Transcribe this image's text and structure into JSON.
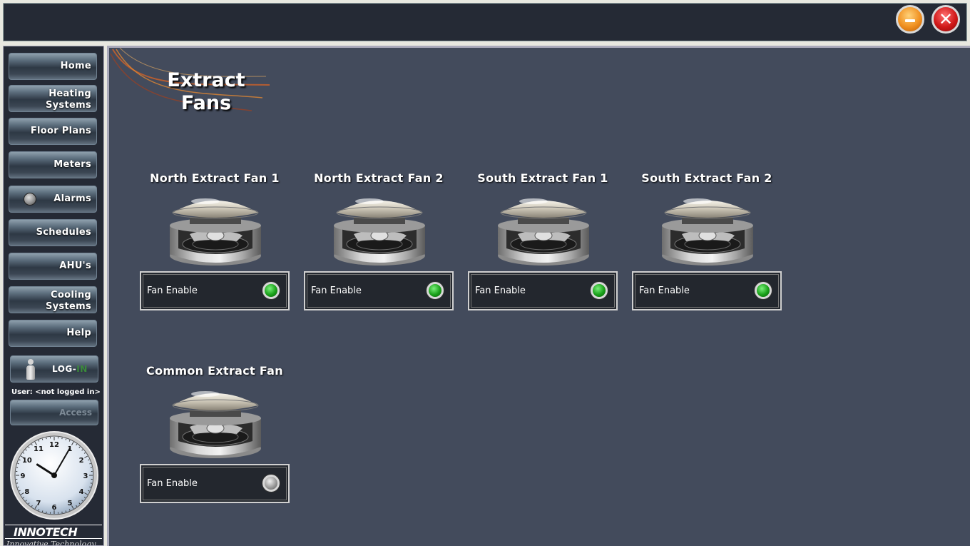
{
  "window": {
    "minimize_label": "minimize",
    "close_label": "close",
    "minimize_color": "#f09020",
    "close_color": "#d01818"
  },
  "sidebar": {
    "nav": [
      {
        "label_line1": "Home",
        "label_line2": ""
      },
      {
        "label_line1": "Heating",
        "label_line2": "Systems"
      },
      {
        "label_line1": "Floor Plans",
        "label_line2": ""
      },
      {
        "label_line1": "Meters",
        "label_line2": ""
      },
      {
        "label_line1": "Alarms",
        "label_line2": "",
        "indicator": "grey"
      },
      {
        "label_line1": "Schedules",
        "label_line2": ""
      },
      {
        "label_line1": "AHU's",
        "label_line2": ""
      },
      {
        "label_line1": "Cooling",
        "label_line2": "Systems"
      },
      {
        "label_line1": "Help",
        "label_line2": ""
      }
    ],
    "login": {
      "label_prefix": "LOG-",
      "label_suffix": "IN"
    },
    "user_text": "User: <not logged in>",
    "access_label": "Access",
    "clock": {
      "hour_label_12": "12",
      "hours": [
        "1",
        "2",
        "3",
        "4",
        "5",
        "6",
        "7",
        "8",
        "9",
        "10",
        "11",
        "12"
      ],
      "time": "10:05"
    },
    "logo": {
      "brand": "INNOTECH",
      "tagline": "Innovative Technology"
    }
  },
  "main": {
    "title_line1": "Extract",
    "title_line2": "Fans",
    "fans": [
      {
        "name": "North Extract Fan 1",
        "control_label": "Fan Enable",
        "status": "on"
      },
      {
        "name": "North Extract Fan 2",
        "control_label": "Fan Enable",
        "status": "on"
      },
      {
        "name": "South Extract Fan 1",
        "control_label": "Fan Enable",
        "status": "on"
      },
      {
        "name": "South Extract Fan 2",
        "control_label": "Fan Enable",
        "status": "on"
      },
      {
        "name": "Common Extract Fan",
        "control_label": "Fan Enable",
        "status": "off"
      }
    ],
    "colors": {
      "status_on": "#19a019",
      "status_off": "#9a9a9a",
      "background": "#434b5c"
    }
  }
}
